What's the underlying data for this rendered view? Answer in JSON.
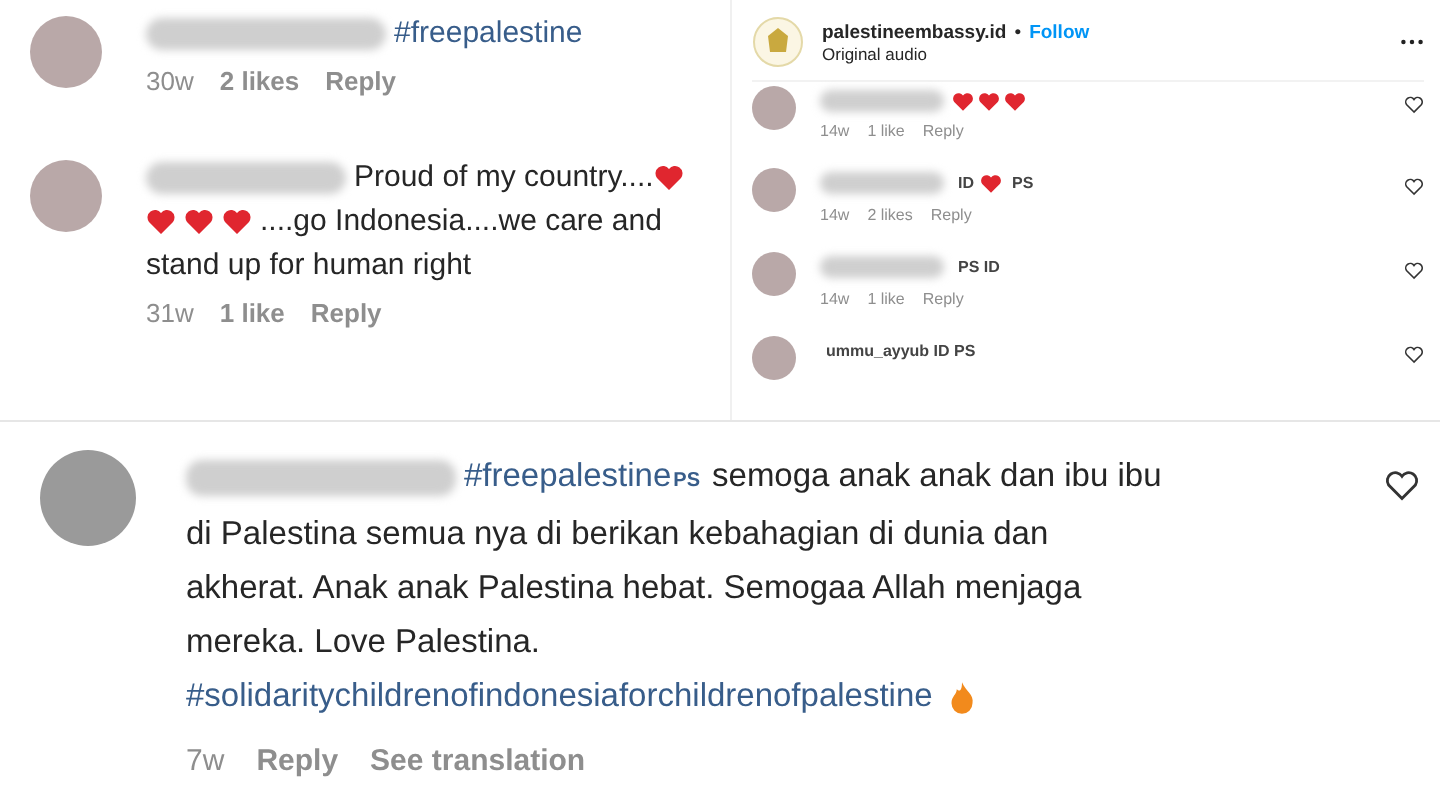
{
  "left_comments": [
    {
      "segments": [
        {
          "kind": "blur"
        },
        {
          "kind": "hashtag",
          "text": "#freepalestine"
        }
      ],
      "time": "30w",
      "likes": "2 likes",
      "reply": "Reply"
    },
    {
      "segments": [
        {
          "kind": "blur"
        },
        {
          "kind": "text",
          "text": "Proud of my country...."
        },
        {
          "kind": "heart"
        },
        {
          "kind": "break"
        },
        {
          "kind": "heart"
        },
        {
          "kind": "heart"
        },
        {
          "kind": "heart"
        },
        {
          "kind": "text",
          "text": "....go Indonesia....we care and"
        },
        {
          "kind": "break"
        },
        {
          "kind": "text",
          "text": "stand up for human right"
        }
      ],
      "time": "31w",
      "likes": "1 like",
      "reply": "Reply"
    }
  ],
  "post_panel": {
    "account": "palestineembassy.id",
    "separator": "•",
    "follow": "Follow",
    "subtitle": "Original audio",
    "comments": [
      {
        "segments": [
          {
            "kind": "blur"
          },
          {
            "kind": "heart"
          },
          {
            "kind": "heart"
          },
          {
            "kind": "heart"
          }
        ],
        "time": "14w",
        "likes": "1 like",
        "reply": "Reply"
      },
      {
        "segments": [
          {
            "kind": "blur"
          },
          {
            "kind": "flag",
            "text": "ID"
          },
          {
            "kind": "heart"
          },
          {
            "kind": "flag",
            "text": "PS"
          }
        ],
        "time": "14w",
        "likes": "2 likes",
        "reply": "Reply"
      },
      {
        "segments": [
          {
            "kind": "blur"
          },
          {
            "kind": "flag",
            "text": "PS ID"
          }
        ],
        "time": "14w",
        "likes": "1 like",
        "reply": "Reply"
      },
      {
        "segments": [
          {
            "kind": "flag",
            "text": "ummu_ayyub ID PS"
          }
        ]
      }
    ]
  },
  "main_comment": {
    "segments": [
      {
        "kind": "blur"
      },
      {
        "kind": "hashtag",
        "text": "#freepalestine"
      },
      {
        "kind": "flag",
        "text": "PS"
      },
      {
        "kind": "text",
        "text": "semoga anak anak dan ibu ibu"
      },
      {
        "kind": "break"
      },
      {
        "kind": "text",
        "text": "di Palestina semua nya di berikan kebahagian di dunia dan"
      },
      {
        "kind": "break"
      },
      {
        "kind": "text",
        "text": "akherat. Anak anak Palestina hebat. Semogaa Allah menjaga"
      },
      {
        "kind": "break"
      },
      {
        "kind": "text",
        "text": "mereka. Love Palestina."
      },
      {
        "kind": "break"
      },
      {
        "kind": "hashtag",
        "text": "#solidaritychildrenofindonesiaforchildrenofpalestine"
      },
      {
        "kind": "fire"
      }
    ],
    "time": "7w",
    "reply": "Reply",
    "translate": "See translation"
  }
}
